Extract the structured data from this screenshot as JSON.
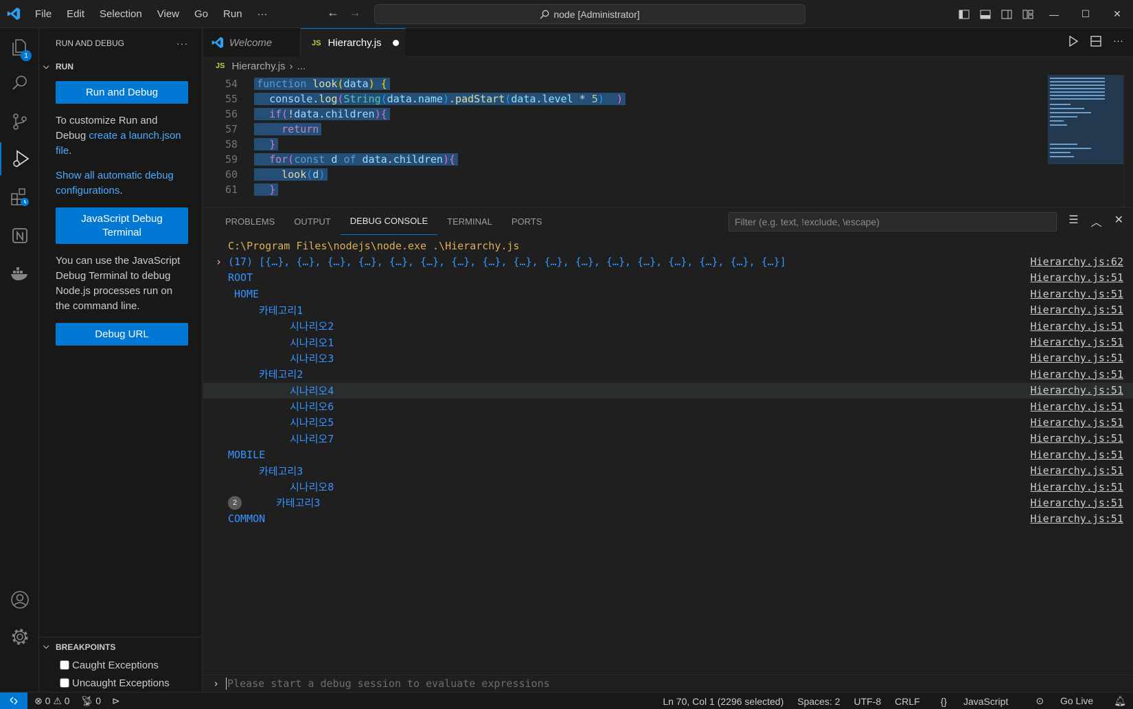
{
  "titlebar": {
    "menu": [
      "File",
      "Edit",
      "Selection",
      "View",
      "Go",
      "Run",
      "···"
    ],
    "command_center": "node [Administrator]"
  },
  "activity": {
    "explorer_badge": "1"
  },
  "sidebar": {
    "title": "RUN AND DEBUG",
    "more": "···",
    "run_section": "RUN",
    "run_debug_button": "Run and Debug",
    "customize_text": "To customize Run and Debug ",
    "customize_link": "create a launch.json file",
    "customize_end": ".",
    "show_all_link": "Show all automatic debug configurations",
    "show_all_end": ".",
    "js_terminal_button": "JavaScript Debug Terminal",
    "js_terminal_text": "You can use the JavaScript Debug Terminal to debug Node.js processes run on the command line.",
    "debug_url_button": "Debug URL",
    "breakpoints_section": "BREAKPOINTS",
    "breakpoints": [
      "Caught Exceptions",
      "Uncaught Exceptions"
    ]
  },
  "editor": {
    "tabs": [
      {
        "label": "Welcome"
      },
      {
        "label": "Hierarchy.js",
        "icon": "JS"
      }
    ],
    "breadcrumb": {
      "file": "Hierarchy.js",
      "rest": "..."
    },
    "lines": [
      {
        "n": "54"
      },
      {
        "n": "55"
      },
      {
        "n": "56"
      },
      {
        "n": "57"
      },
      {
        "n": "58"
      },
      {
        "n": "59"
      },
      {
        "n": "60"
      },
      {
        "n": "61"
      }
    ]
  },
  "panel": {
    "tabs": [
      "PROBLEMS",
      "OUTPUT",
      "DEBUG CONSOLE",
      "TERMINAL",
      "PORTS"
    ],
    "active_tab": "DEBUG CONSOLE",
    "filter_placeholder": "Filter (e.g. text, !exclude, \\escape)",
    "command": "C:\\Program Files\\nodejs\\node.exe .\\Hierarchy.js",
    "array_line": "(17) [{…}, {…}, {…}, {…}, {…}, {…}, {…}, {…}, {…}, {…}, {…}, {…}, {…}, {…}, {…}, {…}, {…}]",
    "array_src": "Hierarchy.js:62",
    "rows": [
      {
        "text": "ROOT",
        "src": "Hierarchy.js:51"
      },
      {
        "text": "HOME",
        "src": "Hierarchy.js:51"
      },
      {
        "text": "카테고리1",
        "src": "Hierarchy.js:51"
      },
      {
        "text": "시나리오2",
        "src": "Hierarchy.js:51"
      },
      {
        "text": "시나리오1",
        "src": "Hierarchy.js:51"
      },
      {
        "text": "시나리오3",
        "src": "Hierarchy.js:51"
      },
      {
        "text": "카테고리2",
        "src": "Hierarchy.js:51"
      },
      {
        "text": "시나리오4",
        "src": "Hierarchy.js:51"
      },
      {
        "text": "시나리오6",
        "src": "Hierarchy.js:51"
      },
      {
        "text": "시나리오5",
        "src": "Hierarchy.js:51"
      },
      {
        "text": "시나리오7",
        "src": "Hierarchy.js:51"
      },
      {
        "text": "MOBILE",
        "src": "Hierarchy.js:51"
      },
      {
        "text": "카테고리3",
        "src": "Hierarchy.js:51"
      },
      {
        "text": "시나리오8",
        "src": "Hierarchy.js:51"
      },
      {
        "text": "카테고리3",
        "src": "Hierarchy.js:51",
        "count": "2"
      },
      {
        "text": "COMMON",
        "src": "Hierarchy.js:51"
      }
    ],
    "repl_placeholder": "Please start a debug session to evaluate expressions"
  },
  "status": {
    "errors": "0",
    "warnings": "0",
    "ports": "0",
    "position": "Ln 70, Col 1 (2296 selected)",
    "spaces": "Spaces: 2",
    "encoding": "UTF-8",
    "eol": "CRLF",
    "language": "JavaScript",
    "golive": "Go Live"
  }
}
